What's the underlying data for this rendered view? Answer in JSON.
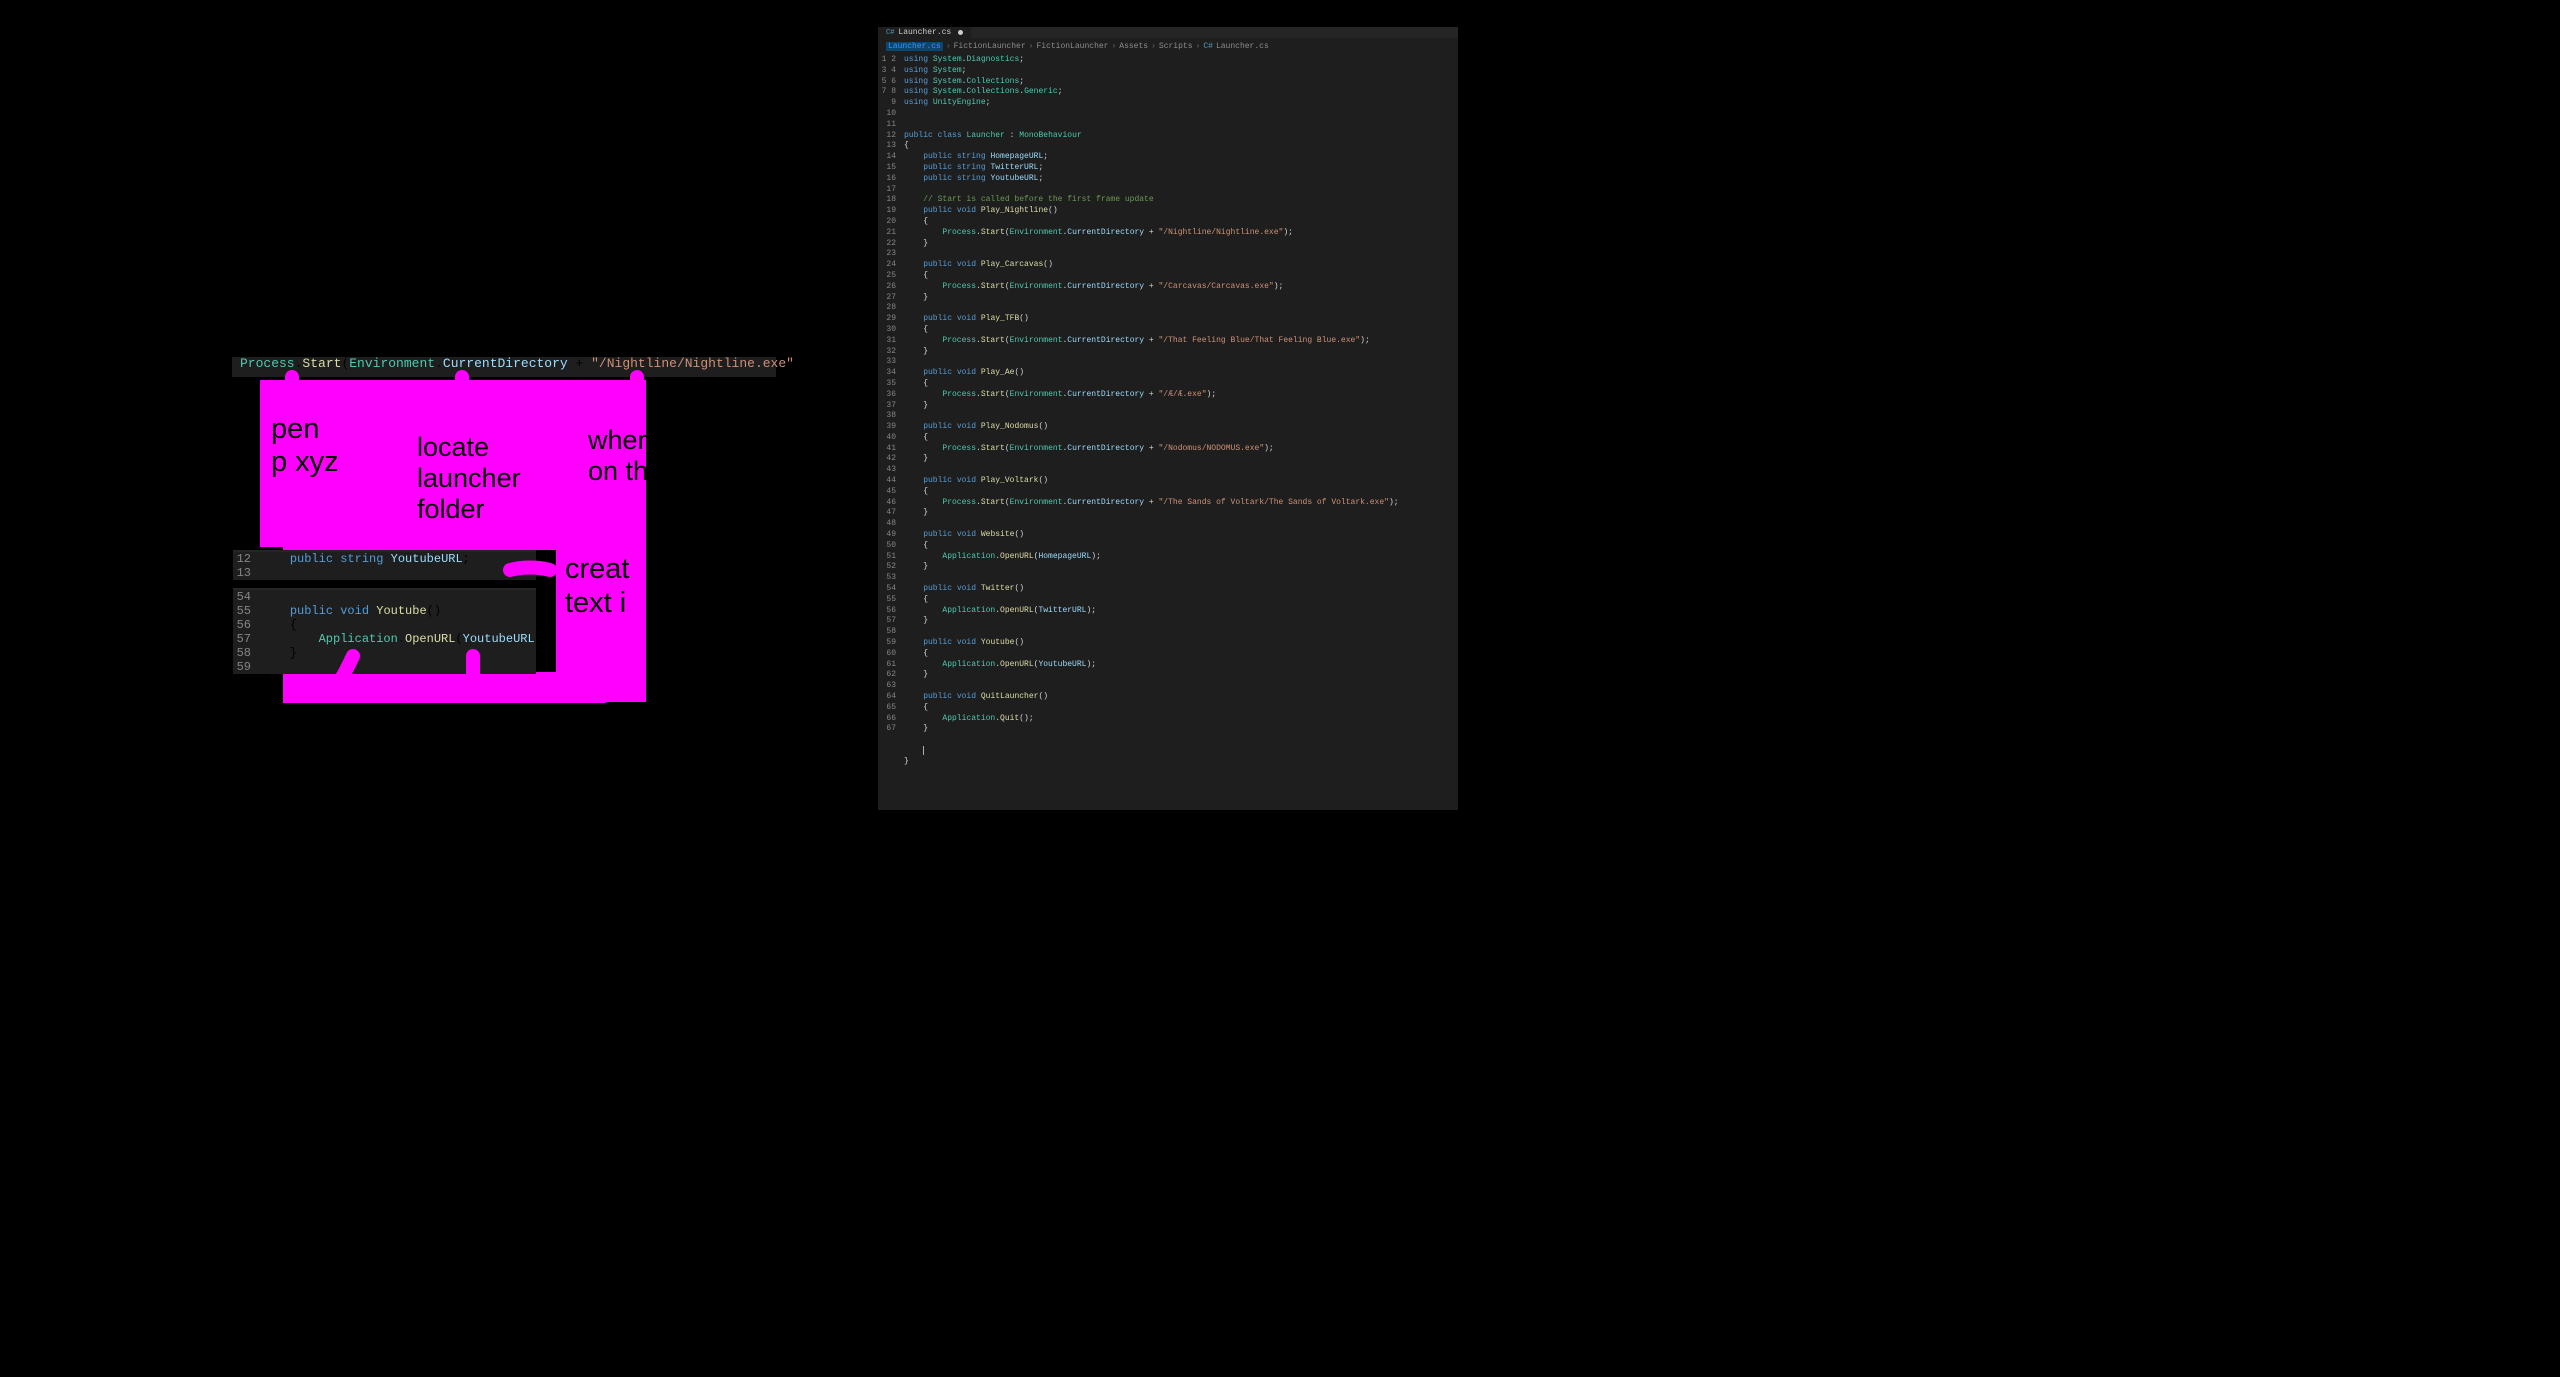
{
  "tab": {
    "icon": "C#",
    "name": "Launcher.cs"
  },
  "breadcrumbs": {
    "highlighted": "Launcher.cs",
    "parts": [
      "FictionLauncher",
      "FictionLauncher",
      "Assets",
      "Scripts",
      "Launcher.cs"
    ]
  },
  "code_lines": [
    {
      "n": 1,
      "h": "<span class='k'>using</span> <span class='t'>System</span>.<span class='t'>Diagnostics</span>;"
    },
    {
      "n": 2,
      "h": "<span class='k'>using</span> <span class='t'>System</span>;"
    },
    {
      "n": 3,
      "h": "<span class='k'>using</span> <span class='t'>System</span>.<span class='t'>Collections</span>;"
    },
    {
      "n": 4,
      "h": "<span class='k'>using</span> <span class='t'>System</span>.<span class='t'>Collections</span>.<span class='t'>Generic</span>;"
    },
    {
      "n": 5,
      "h": "<span class='k'>using</span> <span class='t'>UnityEngine</span>;"
    },
    {
      "n": 6,
      "h": ""
    },
    {
      "n": 7,
      "h": ""
    },
    {
      "n": 8,
      "h": "<span class='k'>public</span> <span class='k'>class</span> <span class='t'>Launcher</span> : <span class='t'>MonoBehaviour</span>"
    },
    {
      "n": 9,
      "h": "{"
    },
    {
      "n": 10,
      "h": "    <span class='k'>public</span> <span class='k'>string</span> <span class='v'>HomepageURL</span>;"
    },
    {
      "n": 11,
      "h": "    <span class='k'>public</span> <span class='k'>string</span> <span class='v'>TwitterURL</span>;"
    },
    {
      "n": 12,
      "h": "    <span class='k'>public</span> <span class='k'>string</span> <span class='v'>YoutubeURL</span>;"
    },
    {
      "n": 13,
      "h": ""
    },
    {
      "n": 14,
      "h": "    <span class='c'>// Start is called before the first frame update</span>"
    },
    {
      "n": 15,
      "h": "    <span class='k'>public</span> <span class='k'>void</span> <span class='m'>Play_Nightline</span>()"
    },
    {
      "n": 16,
      "h": "    {"
    },
    {
      "n": 17,
      "h": "        <span class='t'>Process</span>.<span class='m'>Start</span>(<span class='t'>Environment</span>.<span class='v'>CurrentDirectory</span> + <span class='s'>\"/Nightline/Nightline.exe\"</span>);"
    },
    {
      "n": 18,
      "h": "    }"
    },
    {
      "n": 19,
      "h": ""
    },
    {
      "n": 20,
      "h": "    <span class='k'>public</span> <span class='k'>void</span> <span class='m'>Play_Carcavas</span>()"
    },
    {
      "n": 21,
      "h": "    {"
    },
    {
      "n": 22,
      "h": "        <span class='t'>Process</span>.<span class='m'>Start</span>(<span class='t'>Environment</span>.<span class='v'>CurrentDirectory</span> + <span class='s'>\"/Carcavas/Carcavas.exe\"</span>);"
    },
    {
      "n": 23,
      "h": "    }"
    },
    {
      "n": 24,
      "h": ""
    },
    {
      "n": 25,
      "h": "    <span class='k'>public</span> <span class='k'>void</span> <span class='m'>Play_TFB</span>()"
    },
    {
      "n": 26,
      "h": "    {"
    },
    {
      "n": 27,
      "h": "        <span class='t'>Process</span>.<span class='m'>Start</span>(<span class='t'>Environment</span>.<span class='v'>CurrentDirectory</span> + <span class='s'>\"/That Feeling Blue/That Feeling Blue.exe\"</span>);"
    },
    {
      "n": 28,
      "h": "    }"
    },
    {
      "n": 29,
      "h": ""
    },
    {
      "n": 30,
      "h": "    <span class='k'>public</span> <span class='k'>void</span> <span class='m'>Play_Ae</span>()"
    },
    {
      "n": 31,
      "h": "    {"
    },
    {
      "n": 32,
      "h": "        <span class='t'>Process</span>.<span class='m'>Start</span>(<span class='t'>Environment</span>.<span class='v'>CurrentDirectory</span> + <span class='s'>\"/Æ/Æ.exe\"</span>);"
    },
    {
      "n": 33,
      "h": "    }"
    },
    {
      "n": 34,
      "h": ""
    },
    {
      "n": 35,
      "h": "    <span class='k'>public</span> <span class='k'>void</span> <span class='m'>Play_Nodomus</span>()"
    },
    {
      "n": 36,
      "h": "    {"
    },
    {
      "n": 37,
      "h": "        <span class='t'>Process</span>.<span class='m'>Start</span>(<span class='t'>Environment</span>.<span class='v'>CurrentDirectory</span> + <span class='s'>\"/Nodomus/NODOMUS.exe\"</span>);"
    },
    {
      "n": 38,
      "h": "    }"
    },
    {
      "n": 39,
      "h": ""
    },
    {
      "n": 40,
      "h": "    <span class='k'>public</span> <span class='k'>void</span> <span class='m'>Play_Voltark</span>()"
    },
    {
      "n": 41,
      "h": "    {"
    },
    {
      "n": 42,
      "h": "        <span class='t'>Process</span>.<span class='m'>Start</span>(<span class='t'>Environment</span>.<span class='v'>CurrentDirectory</span> + <span class='s'>\"/The Sands of Voltark/The Sands of Voltark.exe\"</span>);"
    },
    {
      "n": 43,
      "h": "    }"
    },
    {
      "n": 44,
      "h": ""
    },
    {
      "n": 45,
      "h": "    <span class='k'>public</span> <span class='k'>void</span> <span class='m'>Website</span>()"
    },
    {
      "n": 46,
      "h": "    {"
    },
    {
      "n": 47,
      "h": "        <span class='t'>Application</span>.<span class='m'>OpenURL</span>(<span class='v'>HomepageURL</span>);"
    },
    {
      "n": 48,
      "h": "    }"
    },
    {
      "n": 49,
      "h": ""
    },
    {
      "n": 50,
      "h": "    <span class='k'>public</span> <span class='k'>void</span> <span class='m'>Twitter</span>()"
    },
    {
      "n": 51,
      "h": "    {"
    },
    {
      "n": 52,
      "h": "        <span class='t'>Application</span>.<span class='m'>OpenURL</span>(<span class='v'>TwitterURL</span>);"
    },
    {
      "n": 53,
      "h": "    }"
    },
    {
      "n": 54,
      "h": ""
    },
    {
      "n": 55,
      "h": "    <span class='k'>public</span> <span class='k'>void</span> <span class='m'>Youtube</span>()"
    },
    {
      "n": 56,
      "h": "    {"
    },
    {
      "n": 57,
      "h": "        <span class='t'>Application</span>.<span class='m'>OpenURL</span>(<span class='v'>YoutubeURL</span>);"
    },
    {
      "n": 58,
      "h": "    }"
    },
    {
      "n": 59,
      "h": ""
    },
    {
      "n": 60,
      "h": "    <span class='k'>public</span> <span class='k'>void</span> <span class='m'>QuitLauncher</span>()"
    },
    {
      "n": 61,
      "h": "    {"
    },
    {
      "n": 62,
      "h": "        <span class='t'>Application</span>.<span class='m'>Quit</span>();"
    },
    {
      "n": 63,
      "h": "    }"
    },
    {
      "n": 64,
      "h": ""
    },
    {
      "n": 65,
      "h": "    <span class='cursor'></span>"
    },
    {
      "n": 66,
      "h": "}"
    },
    {
      "n": 67,
      "h": ""
    }
  ],
  "annotation": {
    "top_code": "Process.Start(Environment.CurrentDirectory + \"/Nightline/Nightline.exe\");",
    "labels": {
      "a1_line1": "pen",
      "a1_line2": "p xyz",
      "a2_line1": "locate",
      "a2_line2": "launcher",
      "a2_line3": "folder",
      "a3_line1": "wher",
      "a3_line2": "on th",
      "a4_line1": "creat",
      "a4_line2": "text i"
    },
    "snippet1": [
      {
        "n": "12",
        "h": "    <span class='k'>public</span> <span class='k'>string</span> <span class='v'>YoutubeURL</span>;"
      },
      {
        "n": "13",
        "h": ""
      }
    ],
    "snippet2": [
      {
        "n": "54",
        "h": ""
      },
      {
        "n": "55",
        "h": "    <span class='k'>public</span> <span class='k'>void</span> <span class='m'>Youtube</span>()"
      },
      {
        "n": "56",
        "h": "    {"
      },
      {
        "n": "57",
        "h": "        <span class='t'>Application</span>.<span class='m'>OpenURL</span>(<span class='v'>YoutubeURL</span>);"
      },
      {
        "n": "58",
        "h": "    }"
      },
      {
        "n": "59",
        "h": ""
      }
    ]
  }
}
